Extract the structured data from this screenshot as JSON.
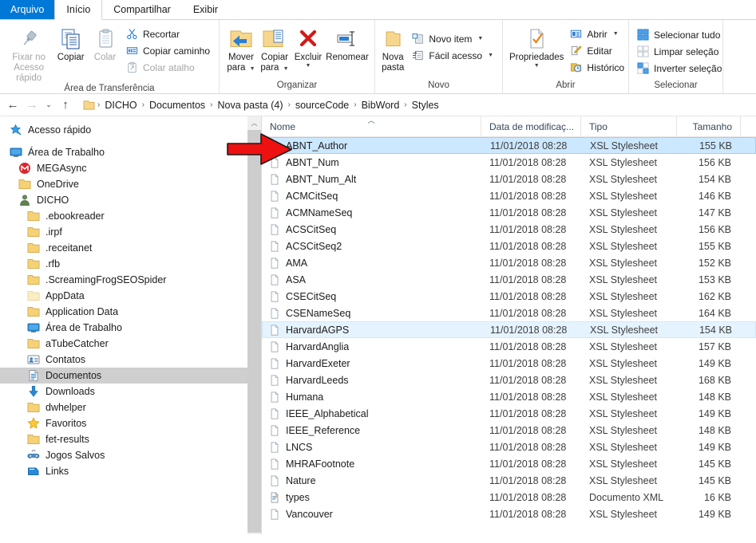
{
  "window": {
    "title": "Styles"
  },
  "ribbon": {
    "tabs": [
      {
        "label": "Arquivo",
        "kind": "file"
      },
      {
        "label": "Início",
        "kind": "active"
      },
      {
        "label": "Compartilhar",
        "kind": "normal"
      },
      {
        "label": "Exibir",
        "kind": "normal"
      }
    ],
    "groups": [
      {
        "name": "clipboard",
        "label": "Área de Transferência",
        "big": [
          {
            "label_line1": "Fixar no",
            "label_line2": "Acesso rápido",
            "icon": "pin-icon",
            "disabled": true
          },
          {
            "label_line1": "Copiar",
            "label_line2": "",
            "icon": "copy-icon",
            "disabled": false
          },
          {
            "label_line1": "Colar",
            "label_line2": "",
            "icon": "paste-icon",
            "disabled": true
          }
        ],
        "small": [
          {
            "label": "Recortar",
            "icon": "scissors-icon",
            "disabled": false
          },
          {
            "label": "Copiar caminho",
            "icon": "copy-path-icon",
            "disabled": false
          },
          {
            "label": "Colar atalho",
            "icon": "paste-shortcut-icon",
            "disabled": true
          }
        ]
      },
      {
        "name": "organize",
        "label": "Organizar",
        "big": [
          {
            "label_line1": "Mover",
            "label_line2": "para",
            "icon": "move-to-icon",
            "dropdown": true
          },
          {
            "label_line1": "Copiar",
            "label_line2": "para",
            "icon": "copy-to-icon",
            "dropdown": true
          },
          {
            "label_line1": "Excluir",
            "label_line2": "",
            "icon": "delete-icon",
            "dropdown": true
          },
          {
            "label_line1": "Renomear",
            "label_line2": "",
            "icon": "rename-icon",
            "dropdown": false
          }
        ]
      },
      {
        "name": "new",
        "label": "Novo",
        "big": [
          {
            "label_line1": "Nova",
            "label_line2": "pasta",
            "icon": "new-folder-icon",
            "dropdown": false
          }
        ],
        "small": [
          {
            "label": "Novo item",
            "icon": "new-item-icon",
            "dropdown": true
          },
          {
            "label": "Fácil acesso",
            "icon": "easy-access-icon",
            "dropdown": true
          }
        ]
      },
      {
        "name": "open",
        "label": "Abrir",
        "big": [
          {
            "label_line1": "Propriedades",
            "label_line2": "",
            "icon": "properties-icon",
            "dropdown": true
          }
        ],
        "small": [
          {
            "label": "Abrir",
            "icon": "open-icon",
            "dropdown": true
          },
          {
            "label": "Editar",
            "icon": "edit-icon",
            "dropdown": false
          },
          {
            "label": "Histórico",
            "icon": "history-icon",
            "dropdown": false
          }
        ]
      },
      {
        "name": "select",
        "label": "Selecionar",
        "small": [
          {
            "label": "Selecionar tudo",
            "icon": "select-all-icon"
          },
          {
            "label": "Limpar seleção",
            "icon": "clear-selection-icon"
          },
          {
            "label": "Inverter seleção",
            "icon": "invert-selection-icon"
          }
        ]
      }
    ]
  },
  "addressbar": {
    "back": "←",
    "forward": "→",
    "recent": "⌄",
    "up": "↑",
    "crumbs": [
      "DICHO",
      "Documentos",
      "Nova pasta (4)",
      "sourceCode",
      "BibWord",
      "Styles"
    ]
  },
  "navpane": {
    "items": [
      {
        "label": "Acesso rápido",
        "icon": "star-pin-icon",
        "indent": 0,
        "selected": false,
        "gap_after": true
      },
      {
        "label": "Área de Trabalho",
        "icon": "desktop-icon",
        "indent": 0,
        "selected": false
      },
      {
        "label": "MEGAsync",
        "icon": "megasync-icon",
        "indent": 1,
        "selected": false
      },
      {
        "label": "OneDrive",
        "icon": "folder-icon",
        "indent": 1,
        "selected": false
      },
      {
        "label": "DICHO",
        "icon": "user-icon",
        "indent": 1,
        "selected": false
      },
      {
        "label": ".ebookreader",
        "icon": "folder-icon",
        "indent": 2,
        "selected": false
      },
      {
        "label": ".irpf",
        "icon": "folder-icon",
        "indent": 2,
        "selected": false
      },
      {
        "label": ".receitanet",
        "icon": "folder-icon",
        "indent": 2,
        "selected": false
      },
      {
        "label": ".rfb",
        "icon": "folder-icon",
        "indent": 2,
        "selected": false
      },
      {
        "label": ".ScreamingFrogSEOSpider",
        "icon": "folder-icon",
        "indent": 2,
        "selected": false
      },
      {
        "label": "AppData",
        "icon": "folder-faded-icon",
        "indent": 2,
        "selected": false
      },
      {
        "label": "Application Data",
        "icon": "folder-icon",
        "indent": 2,
        "selected": false
      },
      {
        "label": "Área de Trabalho",
        "icon": "desktop-icon",
        "indent": 2,
        "selected": false
      },
      {
        "label": "aTubeCatcher",
        "icon": "folder-icon",
        "indent": 2,
        "selected": false
      },
      {
        "label": "Contatos",
        "icon": "contacts-icon",
        "indent": 2,
        "selected": false
      },
      {
        "label": "Documentos",
        "icon": "documents-icon",
        "indent": 2,
        "selected": true
      },
      {
        "label": "Downloads",
        "icon": "downloads-icon",
        "indent": 2,
        "selected": false
      },
      {
        "label": "dwhelper",
        "icon": "folder-icon",
        "indent": 2,
        "selected": false
      },
      {
        "label": "Favoritos",
        "icon": "favorites-star-icon",
        "indent": 2,
        "selected": false
      },
      {
        "label": "fet-results",
        "icon": "folder-icon",
        "indent": 2,
        "selected": false
      },
      {
        "label": "Jogos Salvos",
        "icon": "saved-games-icon",
        "indent": 2,
        "selected": false
      },
      {
        "label": "Links",
        "icon": "links-icon",
        "indent": 2,
        "selected": false
      }
    ]
  },
  "filelist": {
    "columns": [
      {
        "key": "name",
        "label": "Nome",
        "sorted": "asc"
      },
      {
        "key": "date",
        "label": "Data de modificaç...",
        "sorted": ""
      },
      {
        "key": "type",
        "label": "Tipo",
        "sorted": ""
      },
      {
        "key": "size",
        "label": "Tamanho",
        "sorted": ""
      }
    ],
    "rows": [
      {
        "name": "ABNT_Author",
        "date": "11/01/2018 08:28",
        "type": "XSL Stylesheet",
        "size": "155 KB",
        "icon": "xsl-file-icon",
        "state": "selected"
      },
      {
        "name": "ABNT_Num",
        "date": "11/01/2018 08:28",
        "type": "XSL Stylesheet",
        "size": "156 KB",
        "icon": "xsl-file-icon",
        "state": ""
      },
      {
        "name": "ABNT_Num_Alt",
        "date": "11/01/2018 08:28",
        "type": "XSL Stylesheet",
        "size": "154 KB",
        "icon": "xsl-file-icon",
        "state": ""
      },
      {
        "name": "ACMCitSeq",
        "date": "11/01/2018 08:28",
        "type": "XSL Stylesheet",
        "size": "146 KB",
        "icon": "xsl-file-icon",
        "state": ""
      },
      {
        "name": "ACMNameSeq",
        "date": "11/01/2018 08:28",
        "type": "XSL Stylesheet",
        "size": "147 KB",
        "icon": "xsl-file-icon",
        "state": ""
      },
      {
        "name": "ACSCitSeq",
        "date": "11/01/2018 08:28",
        "type": "XSL Stylesheet",
        "size": "156 KB",
        "icon": "xsl-file-icon",
        "state": ""
      },
      {
        "name": "ACSCitSeq2",
        "date": "11/01/2018 08:28",
        "type": "XSL Stylesheet",
        "size": "155 KB",
        "icon": "xsl-file-icon",
        "state": ""
      },
      {
        "name": "AMA",
        "date": "11/01/2018 08:28",
        "type": "XSL Stylesheet",
        "size": "152 KB",
        "icon": "xsl-file-icon",
        "state": ""
      },
      {
        "name": "ASA",
        "date": "11/01/2018 08:28",
        "type": "XSL Stylesheet",
        "size": "153 KB",
        "icon": "xsl-file-icon",
        "state": ""
      },
      {
        "name": "CSECitSeq",
        "date": "11/01/2018 08:28",
        "type": "XSL Stylesheet",
        "size": "162 KB",
        "icon": "xsl-file-icon",
        "state": ""
      },
      {
        "name": "CSENameSeq",
        "date": "11/01/2018 08:28",
        "type": "XSL Stylesheet",
        "size": "164 KB",
        "icon": "xsl-file-icon",
        "state": ""
      },
      {
        "name": "HarvardAGPS",
        "date": "11/01/2018 08:28",
        "type": "XSL Stylesheet",
        "size": "154 KB",
        "icon": "xsl-file-icon",
        "state": "hover"
      },
      {
        "name": "HarvardAnglia",
        "date": "11/01/2018 08:28",
        "type": "XSL Stylesheet",
        "size": "157 KB",
        "icon": "xsl-file-icon",
        "state": ""
      },
      {
        "name": "HarvardExeter",
        "date": "11/01/2018 08:28",
        "type": "XSL Stylesheet",
        "size": "149 KB",
        "icon": "xsl-file-icon",
        "state": ""
      },
      {
        "name": "HarvardLeeds",
        "date": "11/01/2018 08:28",
        "type": "XSL Stylesheet",
        "size": "168 KB",
        "icon": "xsl-file-icon",
        "state": ""
      },
      {
        "name": "Humana",
        "date": "11/01/2018 08:28",
        "type": "XSL Stylesheet",
        "size": "148 KB",
        "icon": "xsl-file-icon",
        "state": ""
      },
      {
        "name": "IEEE_Alphabetical",
        "date": "11/01/2018 08:28",
        "type": "XSL Stylesheet",
        "size": "149 KB",
        "icon": "xsl-file-icon",
        "state": ""
      },
      {
        "name": "IEEE_Reference",
        "date": "11/01/2018 08:28",
        "type": "XSL Stylesheet",
        "size": "148 KB",
        "icon": "xsl-file-icon",
        "state": ""
      },
      {
        "name": "LNCS",
        "date": "11/01/2018 08:28",
        "type": "XSL Stylesheet",
        "size": "149 KB",
        "icon": "xsl-file-icon",
        "state": ""
      },
      {
        "name": "MHRAFootnote",
        "date": "11/01/2018 08:28",
        "type": "XSL Stylesheet",
        "size": "145 KB",
        "icon": "xsl-file-icon",
        "state": ""
      },
      {
        "name": "Nature",
        "date": "11/01/2018 08:28",
        "type": "XSL Stylesheet",
        "size": "145 KB",
        "icon": "xsl-file-icon",
        "state": ""
      },
      {
        "name": "types",
        "date": "11/01/2018 08:28",
        "type": "Documento XML",
        "size": "16 KB",
        "icon": "xml-file-icon",
        "state": ""
      },
      {
        "name": "Vancouver",
        "date": "11/01/2018 08:28",
        "type": "XSL Stylesheet",
        "size": "149 KB",
        "icon": "xsl-file-icon",
        "state": ""
      }
    ]
  },
  "annotation": {
    "arrow": "red-arrow-pointing-right",
    "color": "#ee1111"
  },
  "colors": {
    "accent": "#0078d7",
    "selection": "#cce8ff",
    "hover": "#e5f3ff",
    "nav_selection": "#cfcfcf",
    "folder": "#fcd975",
    "annotation_red": "#ee1111"
  }
}
